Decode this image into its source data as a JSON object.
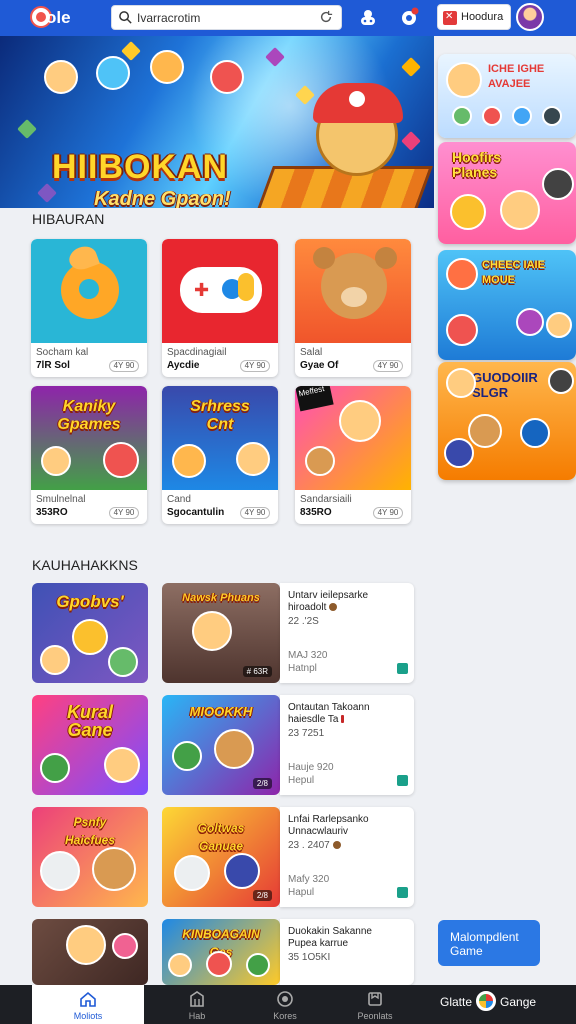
{
  "header": {
    "logo_text": "ole",
    "search_value": "Ivarracrotim",
    "badge_label": "Hoodura"
  },
  "hero": {
    "title": "HIIBOKAN",
    "subtitle": "Kadne Gpaon!"
  },
  "rail": [
    {
      "title": "ICHE IGHE\nAVAJEE"
    },
    {
      "title": "Hoofirs\nPlanes"
    },
    {
      "title": "CHEEC IAIE\nMOUE"
    },
    {
      "title": "GUODOIIR\nSLGR"
    }
  ],
  "sections": {
    "apps_title": "HIBAURAN",
    "list_title": "KAUHAHAKKNS"
  },
  "cards": [
    {
      "name": "Socham kal",
      "meta": "7lR Sol",
      "pill": "4Y 90",
      "thumb_text": ""
    },
    {
      "name": "Spacdinagiail",
      "meta": "Aycdie",
      "pill": "4Y 90",
      "thumb_text": ""
    },
    {
      "name": "Salal",
      "meta": "Gyae Of",
      "pill": "4Y 90",
      "thumb_text": ""
    },
    {
      "name": "Smulnelnal",
      "meta": "353RO",
      "pill": "4Y 90",
      "thumb_text": "Kaniky\nGpames"
    },
    {
      "name": "Cand",
      "meta": "Sgocantulin",
      "pill": "4Y 90",
      "thumb_text": "Srhress\nCnt"
    },
    {
      "name": "Sandarsiaili",
      "meta": "835RO",
      "pill": "4Y 90",
      "thumb_text": "Meffest"
    }
  ],
  "list": [
    {
      "left_text": "Gpobvs'",
      "mid_text": "Nawsk Phuans",
      "tag": "# 63R",
      "l1": "Untarv ieilepsarke",
      "l2": "hiroadolt",
      "l3": "22 .'2S",
      "l4": "MAJ 320",
      "l5": "Hatnpl"
    },
    {
      "left_text": "Kural\nGane",
      "mid_text": "MIOOKKH",
      "tag": "2/8",
      "l1": "Ontautan Takoann",
      "l2": "haiesdle Ta",
      "l3": "23 7251",
      "l4": "Hauje 920",
      "l5": "Hepul"
    },
    {
      "left_text": "Psnfy\nHaicfues",
      "mid_text": "Goltwas\nGanuae",
      "tag": "2/8",
      "l1": "Lnfai Rarlepsankо",
      "l2": "Unnacwlauriv",
      "l3": "23 . 2407",
      "l4": "Mafy 320",
      "l5": "Hapul"
    },
    {
      "left_text": "",
      "mid_text": "KINBOAGAIN\nGes",
      "tag": "",
      "l1": "Duokakin Sakanne",
      "l2": "Pupea karrue",
      "l3": "35 1O5KI",
      "l4": "",
      "l5": ""
    }
  ],
  "cta_label": "Malompdlent Game",
  "bottom_nav": [
    {
      "label": "Moliots"
    },
    {
      "label": "Hab"
    },
    {
      "label": "Kores"
    },
    {
      "label": "Peonlats"
    }
  ],
  "bottom_app": {
    "left": "Glatte",
    "right": "Gange"
  },
  "colors": {
    "primary": "#1f5ad6",
    "accent": "#ffd62a",
    "nav_bg": "#1d1f24"
  }
}
